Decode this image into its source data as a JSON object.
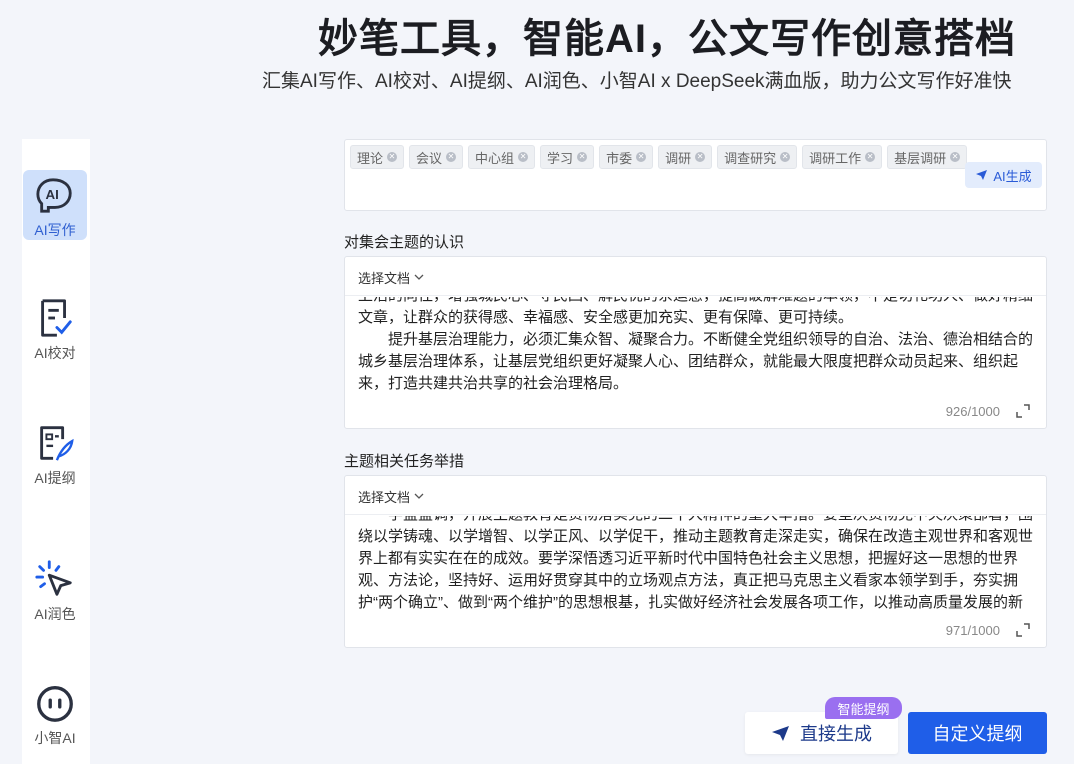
{
  "hero": {
    "title": "妙笔工具，智能AI，公文写作创意搭档",
    "subtitle": "汇集AI写作、AI校对、AI提纲、AI润色、小智AI x DeepSeek满血版，助力公文写作好准快"
  },
  "sidebar": {
    "items": [
      {
        "label": "AI写作",
        "icon": "ai-writing-head-icon",
        "active": true
      },
      {
        "label": "AI校对",
        "icon": "proofread-doc-icon",
        "active": false
      },
      {
        "label": "AI提纲",
        "icon": "outline-doc-pen-icon",
        "active": false
      },
      {
        "label": "AI润色",
        "icon": "polish-sparkle-cursor-icon",
        "active": false
      },
      {
        "label": "小智AI",
        "icon": "robot-face-icon",
        "active": false
      }
    ]
  },
  "keywords": {
    "tags": [
      "理论",
      "会议",
      "中心组",
      "学习",
      "市委",
      "调研",
      "调查研究",
      "调研工作",
      "基层调研"
    ],
    "ai_generate_label": "AI生成"
  },
  "section1": {
    "label": "对集会主题的认识",
    "select_label": "选择文档",
    "paragraphs": [
      "上活的向往，增强城民心、守民回、解民忧的系运感，提高破解难题的本领，不是切礼功人、做好精细文章，让群众的获得感、幸福感、安全感更加充实、更有保障、更可持续。",
      "提升基层治理能力，必须汇集众智、凝聚合力。不断健全党组织领导的自治、法治、德治相结合的城乡基层治理体系，让基层党组织更好凝聚人心、团结群众，就能最大限度把群众动员起来、组织起来，打造共建共治共享的社会治理格局。"
    ],
    "counter": "926/1000"
  },
  "section2": {
    "label": "主题相关任务举措",
    "select_label": "选择文档",
    "paragraphs": [
      "学盛盛调，开展主题教育是贯彻落实党的二十大精神的重大举措。要坚决贯彻党中央决策部署，围绕以学铸魂、以学增智、以学正风、以学促干，推动主题教育走深走实，确保在改造主观世界和客观世界上都有实实在在的成效。要学深悟透习近平新时代中国特色社会主义思想，把握好这一思想的世界观、方法论，坚持好、运用好贯穿其中的立场观点方法，真正把马克思主义看家本领学到手，夯实拥护“两个确立”、做到“两个维护”的思想根基，扎实做好经济社会发展各项工作，以推动高质量发展的新成效检验主题教育成果。"
    ],
    "counter": "971/1000"
  },
  "actions": {
    "badge": "智能提纲",
    "direct_generate": "直接生成",
    "custom_outline": "自定义提纲"
  },
  "colors": {
    "accent": "#1f5ee8",
    "badge": "#9a6ff0",
    "active_bg": "#cfe0fb"
  }
}
